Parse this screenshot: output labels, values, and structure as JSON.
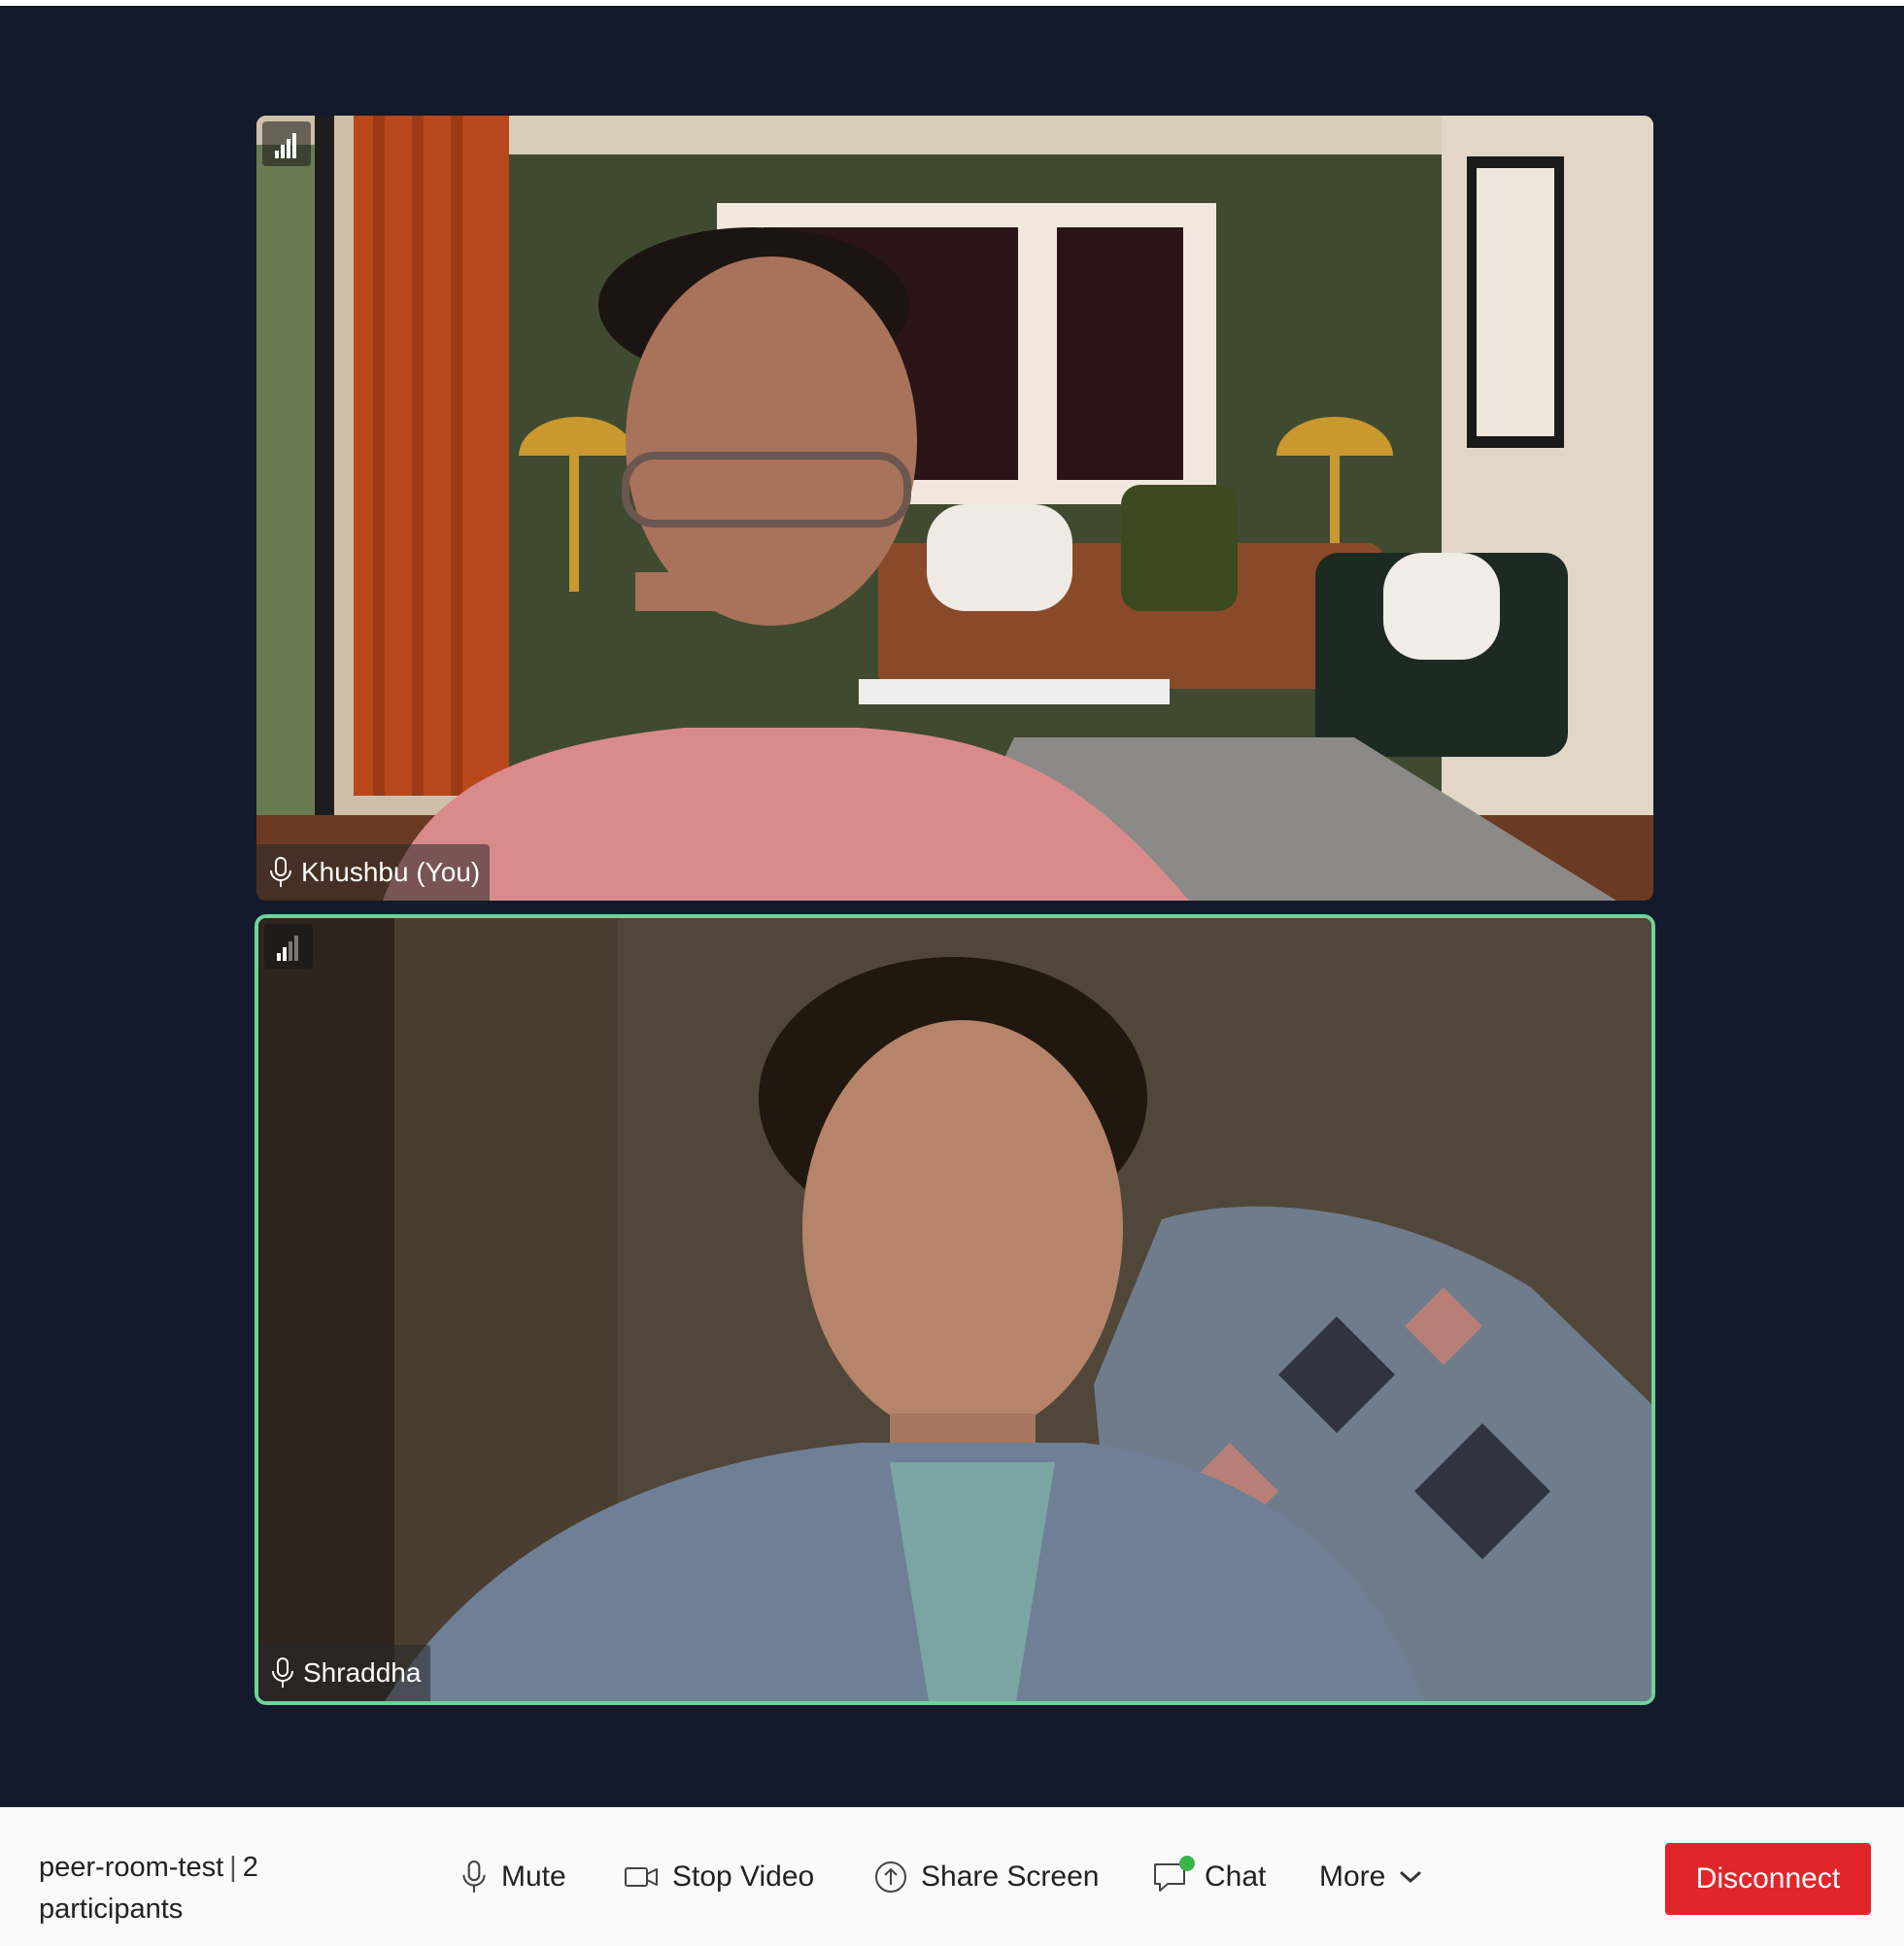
{
  "participants": [
    {
      "name": "Khushbu (You)",
      "signal_bars": 4,
      "speaking": false
    },
    {
      "name": "Shraddha",
      "signal_bars": 2,
      "speaking": true
    }
  ],
  "room": {
    "name": "peer-room-test",
    "separator": "|",
    "participant_count": "2",
    "participants_word": "participants"
  },
  "controls": {
    "mute_label": "Mute",
    "stop_video_label": "Stop Video",
    "share_screen_label": "Share Screen",
    "chat_label": "Chat",
    "more_label": "More",
    "disconnect_label": "Disconnect"
  },
  "colors": {
    "stage_bg": "#121a2b",
    "active_speaker_border": "#6fd39a",
    "disconnect_bg": "#e0262b",
    "chat_unread_dot": "#3bb54a"
  },
  "icons": [
    "signal-icon",
    "microphone-icon",
    "camera-icon",
    "share-screen-icon",
    "chat-icon",
    "chevron-down-icon"
  ]
}
